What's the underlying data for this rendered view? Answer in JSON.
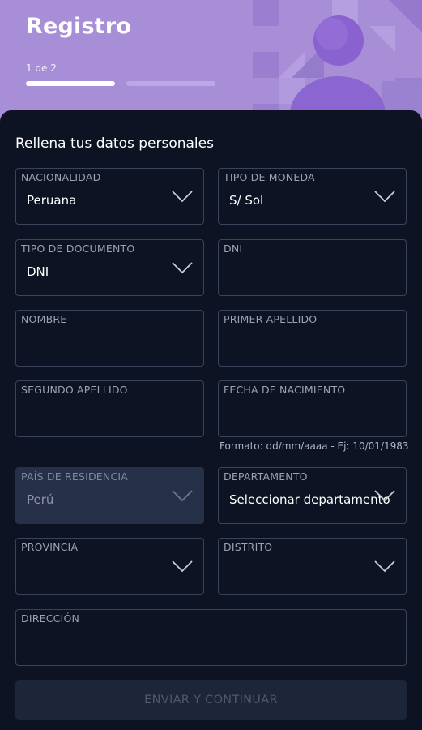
{
  "header": {
    "title": "Registro",
    "step_label": "1 de 2",
    "progress": {
      "current": 1,
      "total": 2
    },
    "colors": {
      "background": "#a78ed6",
      "avatar": "#8c66d0"
    }
  },
  "form": {
    "subtitle": "Rellena tus datos personales",
    "nationality": {
      "label": "NACIONALIDAD",
      "value": "Peruana"
    },
    "currency": {
      "label": "TIPO DE MONEDA",
      "value": "S/ Sol"
    },
    "doc_type": {
      "label": "TIPO DE DOCUMENTO",
      "value": "DNI"
    },
    "doc_number": {
      "label": "DNI",
      "value": ""
    },
    "first_name": {
      "label": "NOMBRE",
      "value": ""
    },
    "last_name_1": {
      "label": "PRIMER APELLIDO",
      "value": ""
    },
    "last_name_2": {
      "label": "SEGUNDO APELLIDO",
      "value": ""
    },
    "birth_date": {
      "label": "FECHA DE NACIMIENTO",
      "value": "",
      "hint": "Formato: dd/mm/aaaa - Ej: 10/01/1983"
    },
    "residence_country": {
      "label": "PAÍS DE RESIDENCIA",
      "value": "Perú",
      "disabled": true
    },
    "department": {
      "label": "DEPARTAMENTO",
      "value": "Seleccionar departamento"
    },
    "province": {
      "label": "PROVINCIA",
      "value": ""
    },
    "district": {
      "label": "DISTRITO",
      "value": ""
    },
    "address": {
      "label": "DIRECCIÓN",
      "value": ""
    },
    "submit_label": "ENVIAR Y CONTINUAR"
  }
}
